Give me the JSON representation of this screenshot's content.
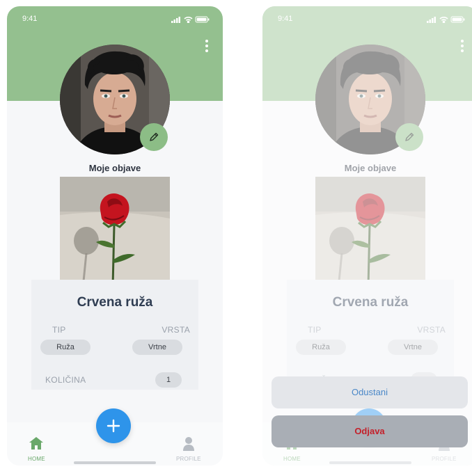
{
  "status_bar": {
    "time": "9:41"
  },
  "profile": {
    "section_title": "Moje objave"
  },
  "post": {
    "title": "Crvena ruža",
    "tip_label": "TIP",
    "tip_value": "Ruža",
    "vrsta_label": "VRSTA",
    "vrsta_value": "Vrtne",
    "kolicina_label": "KOLIČINA",
    "kolicina_value": "1"
  },
  "tabbar": {
    "home_label": "HOME",
    "profile_label": "PROFILE"
  },
  "action_sheet": {
    "cancel_label": "Odustani",
    "logout_label": "Odjava"
  },
  "colors": {
    "header_green": "#94c08f",
    "accent_blue": "#2e94ea",
    "danger_red": "#c4202a",
    "cancel_blue": "#4b88c8"
  },
  "icons": [
    "kebab-menu-icon",
    "pencil-icon",
    "plus-icon",
    "home-icon",
    "profile-icon",
    "signal-icon",
    "wifi-icon",
    "battery-icon"
  ]
}
